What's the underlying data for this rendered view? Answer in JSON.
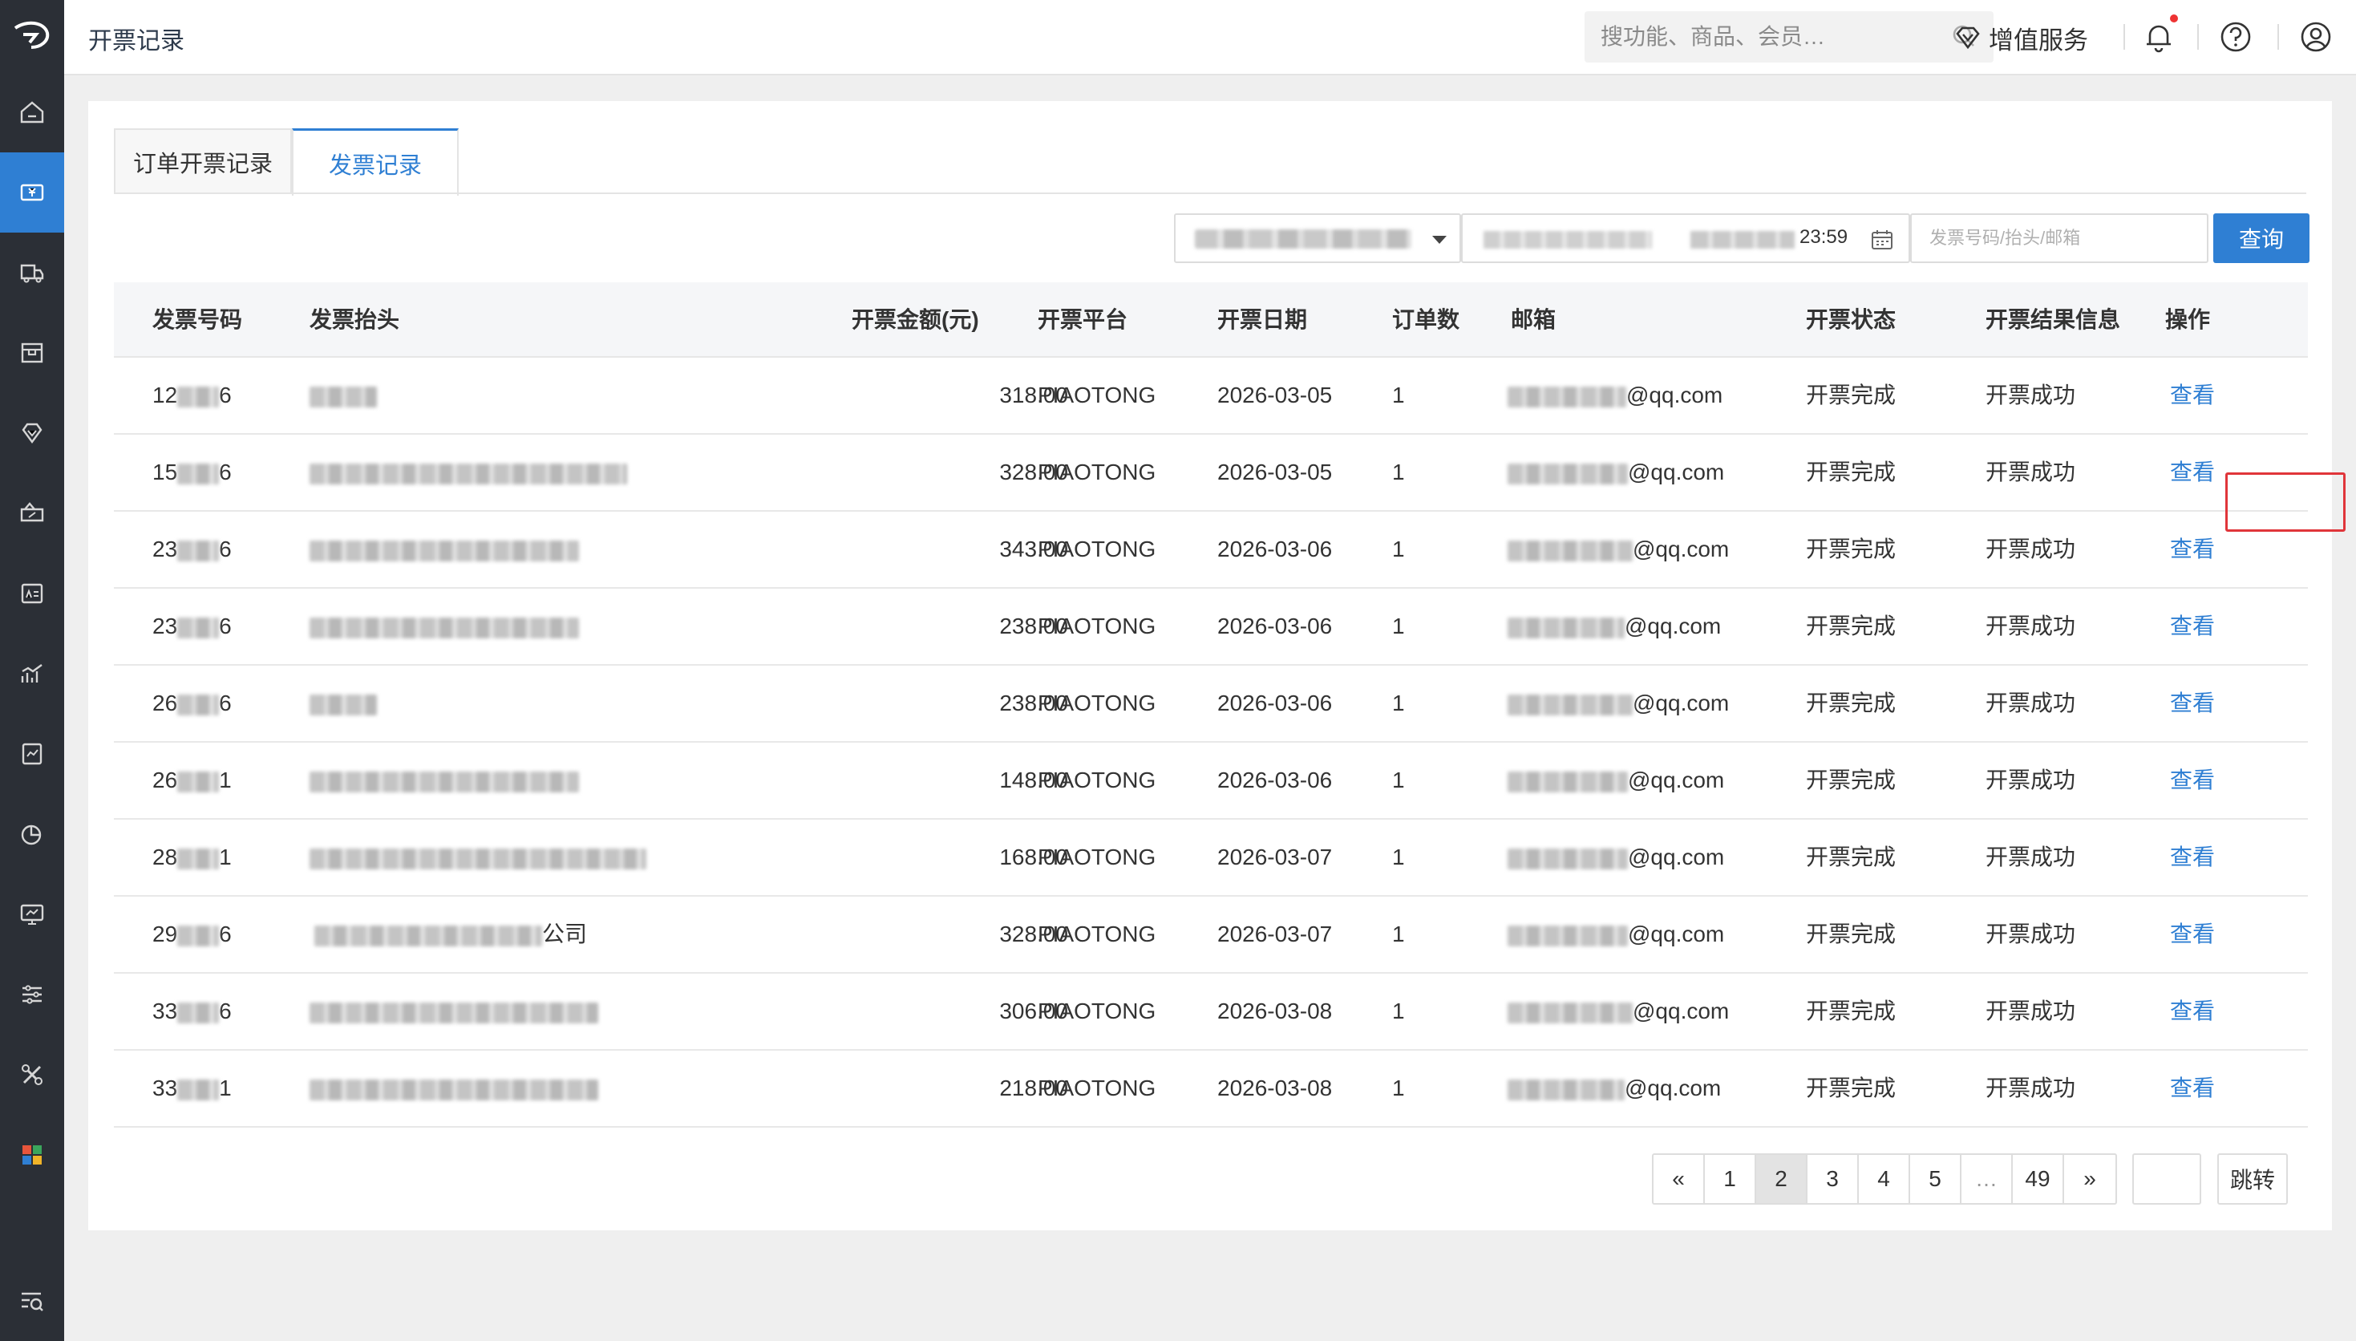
{
  "header": {
    "title": "开票记录",
    "search_placeholder": "搜功能、商品、会员…",
    "value_added_label": "增值服务"
  },
  "tabs": [
    {
      "label": "订单开票记录",
      "active": false
    },
    {
      "label": "发票记录",
      "active": true
    }
  ],
  "filters": {
    "date_end_time": "23:59",
    "search_placeholder": "发票号码/抬头/邮箱",
    "query_button": "查询"
  },
  "table": {
    "headers": [
      "发票号码",
      "发票抬头",
      "开票金额(元)",
      "开票平台",
      "开票日期",
      "订单数",
      "邮箱",
      "开票状态",
      "开票结果信息",
      "操作"
    ],
    "rows": [
      {
        "no_prefix": "12",
        "no_suffix": "6",
        "title_suffix": "",
        "amount": "318.00",
        "platform": "PIAOTONG",
        "date": "2026-03-05",
        "orders": "1",
        "email_suffix": "@qq.com",
        "status": "开票完成",
        "result": "开票成功",
        "action": "查看"
      },
      {
        "no_prefix": "15",
        "no_suffix": "6",
        "title_suffix": "",
        "amount": "328.00",
        "platform": "PIAOTONG",
        "date": "2026-03-05",
        "orders": "1",
        "email_suffix": "@qq.com",
        "status": "开票完成",
        "result": "开票成功",
        "action": "查看"
      },
      {
        "no_prefix": "23",
        "no_suffix": "6",
        "title_suffix": "",
        "amount": "343.00",
        "platform": "PIAOTONG",
        "date": "2026-03-06",
        "orders": "1",
        "email_suffix": "@qq.com",
        "status": "开票完成",
        "result": "开票成功",
        "action": "查看"
      },
      {
        "no_prefix": "23",
        "no_suffix": "6",
        "title_suffix": "",
        "amount": "238.00",
        "platform": "PIAOTONG",
        "date": "2026-03-06",
        "orders": "1",
        "email_suffix": "@qq.com",
        "status": "开票完成",
        "result": "开票成功",
        "action": "查看"
      },
      {
        "no_prefix": "26",
        "no_suffix": "6",
        "title_suffix": "",
        "amount": "238.00",
        "platform": "PIAOTONG",
        "date": "2026-03-06",
        "orders": "1",
        "email_suffix": "@qq.com",
        "status": "开票完成",
        "result": "开票成功",
        "action": "查看"
      },
      {
        "no_prefix": "26",
        "no_suffix": "1",
        "title_suffix": "",
        "amount": "148.00",
        "platform": "PIAOTONG",
        "date": "2026-03-06",
        "orders": "1",
        "email_suffix": "@qq.com",
        "status": "开票完成",
        "result": "开票成功",
        "action": "查看"
      },
      {
        "no_prefix": "28",
        "no_suffix": "1",
        "title_suffix": "",
        "amount": "168.00",
        "platform": "PIAOTONG",
        "date": "2026-03-07",
        "orders": "1",
        "email_suffix": "@qq.com",
        "status": "开票完成",
        "result": "开票成功",
        "action": "查看"
      },
      {
        "no_prefix": "29",
        "no_suffix": "6",
        "title_suffix": "公司",
        "amount": "328.00",
        "platform": "PIAOTONG",
        "date": "2026-03-07",
        "orders": "1",
        "email_suffix": "@qq.com",
        "status": "开票完成",
        "result": "开票成功",
        "action": "查看"
      },
      {
        "no_prefix": "33",
        "no_suffix": "6",
        "title_suffix": "",
        "amount": "306.00",
        "platform": "PIAOTONG",
        "date": "2026-03-08",
        "orders": "1",
        "email_suffix": "@qq.com",
        "status": "开票完成",
        "result": "开票成功",
        "action": "查看"
      },
      {
        "no_prefix": "33",
        "no_suffix": "1",
        "title_suffix": "",
        "amount": "218.00",
        "platform": "PIAOTONG",
        "date": "2026-03-08",
        "orders": "1",
        "email_suffix": "@qq.com",
        "status": "开票完成",
        "result": "开票成功",
        "action": "查看"
      }
    ]
  },
  "pagination": {
    "prev": "«",
    "pages": [
      "1",
      "2",
      "3",
      "4",
      "5",
      "…",
      "49"
    ],
    "current": "2",
    "next": "»",
    "jump_label": "跳转"
  },
  "colors": {
    "accent": "#2f7fd3",
    "sidebar_bg": "#2b2f36",
    "highlight_border": "#e0353a"
  },
  "icons": {
    "sidebar": [
      "home-icon",
      "invoice-icon",
      "truck-icon",
      "box-icon",
      "diamond-icon",
      "coupon-icon",
      "id-card-icon",
      "chart-icon",
      "report-icon",
      "pie-chart-icon",
      "monitor-icon",
      "sliders-icon",
      "tools-icon",
      "apps-icon",
      "search-list-icon"
    ]
  }
}
